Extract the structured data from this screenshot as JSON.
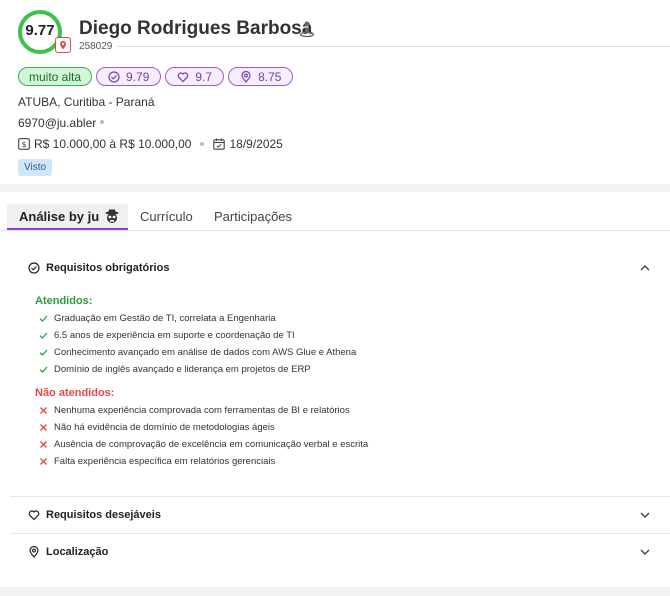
{
  "candidate": {
    "score": "9.77",
    "name": "Diego Rodrigues Barbosa",
    "id": "258029",
    "location": "ATUBA, Curitiba - Paraná",
    "email": "6970@ju.abler",
    "salary": "R$ 10.000,00 à R$ 10.000,00",
    "date": "18/9/2025",
    "status_badge": "Visto",
    "score_fraction": 0.977
  },
  "chips": {
    "level": "muito alta",
    "check_score": "9.79",
    "heart_score": "9.7",
    "pin_score": "8.75"
  },
  "tabs": {
    "analysis": "Análise by ju",
    "curriculo": "Currículo",
    "participacoes": "Participações"
  },
  "requirements": {
    "title": "Requisitos obrigatórios",
    "met_title": "Atendidos:",
    "met": [
      "Graduação em Gestão de TI, correlata a Engenharia",
      "6.5 anos de experiência em suporte e coordenação de TI",
      "Conhecimento avançado em análise de dados com AWS Glue e Athena",
      "Domínio de inglês avançado e liderança em projetos de ERP"
    ],
    "unmet_title": "Não atendidos:",
    "unmet": [
      "Nenhuma experiência comprovada com ferramentas de BI e relatórios",
      "Não há evidência de domínio de metodologias ágeis",
      "Ausência de comprovação de excelência em comunicação verbal e escrita",
      "Falta experiência específica em relatórios gerenciais"
    ]
  },
  "desirable": {
    "title": "Requisitos desejáveis"
  },
  "localization": {
    "title": "Localização"
  },
  "colors": {
    "accent": "#8b3fd1",
    "score_ring": "#3cc153",
    "ok": "#2e9b3d",
    "bad": "#e04848"
  },
  "icons": {
    "score_badge": "pin-badge-icon",
    "person": "person-icon",
    "money": "dollar-icon",
    "calendar": "calendar-icon",
    "spy": "spy-avatar-icon"
  }
}
